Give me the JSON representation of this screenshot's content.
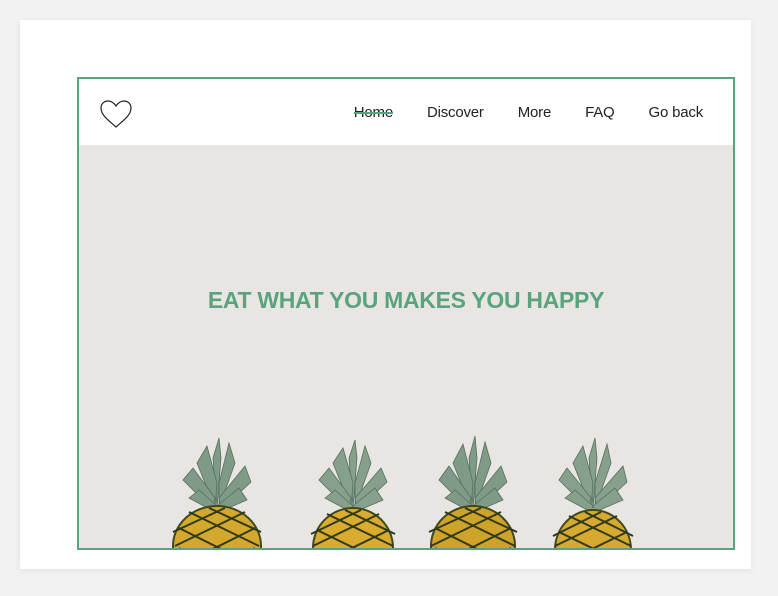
{
  "nav": {
    "items": [
      {
        "label": "Home",
        "active": true
      },
      {
        "label": "Discover",
        "active": false
      },
      {
        "label": "More",
        "active": false
      },
      {
        "label": "FAQ",
        "active": false
      },
      {
        "label": "Go back",
        "active": false
      }
    ]
  },
  "hero": {
    "headline": "EAT WHAT YOU MAKES YOU HAPPY",
    "image_subject": "pineapples"
  },
  "logo": {
    "icon": "heart-icon"
  },
  "colors": {
    "accent": "#5aa37f",
    "hero_background": "#e9e5e2",
    "page_background": "#f2f2f2"
  }
}
